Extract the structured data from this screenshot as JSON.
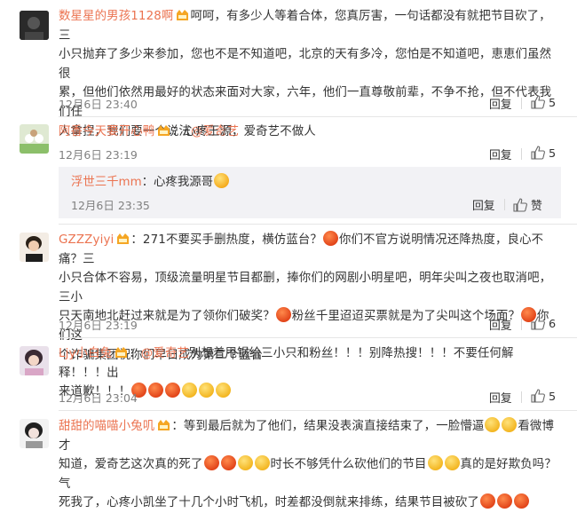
{
  "comments": [
    {
      "user": "数星星的男孩1128啊",
      "lines": [
        "呵呵，有多少人等着合体，您真厉害，一句话都没有就把节目砍了，三",
        "小只抛弃了多少来参加，您也不是不知道吧，北京的天有多冷，您怕是不知道吧，恵恵们虽然很",
        "累，但他们依然用最好的状态来面对大家，六年，他们一直尊敬前辈，不争不抢，但不代表我们任",
        "人拿捏，我们要一个说法"
      ],
      "mention": "@爱奇艺",
      "time": "12月6日 23:40",
      "reply": "回复",
      "likes": "5"
    },
    {
      "user": "阿香今天要开心鸭",
      "text": "：心疼王源，爱奇艺不做人",
      "time": "12月6日 23:19",
      "reply": "回复",
      "likes": "5",
      "sub": {
        "user": "浮世三千mm",
        "text": "：心疼我源哥",
        "time": "12月6日 23:35",
        "reply": "回复",
        "likes": "赞"
      }
    },
    {
      "user": "GZZZyiyi",
      "l1a": "：271不要买手删热度，横仿蓝台？",
      "l1b": "你们不官方说明情况还降热度，良心不痛？三",
      "l2": "小只合体不容易，顶级流量明星节目都删，捧你们的网剧小明星吧，明年尖叫之夜也取消吧，三小",
      "l3a": "只天南地北赶过来就是为了领你们破奖？",
      "l3b": "粉丝千里迢迢买票就是为了尖叫这个场面？",
      "l3c": "你们这",
      "l4": "个诈骗集团祝你们早日成为第二个蓝台",
      "time": "12月6日 23:19",
      "reply": "回复",
      "likes": "6"
    },
    {
      "user": "Ljy小白兔",
      "mention": "@爱奇艺",
      "l1": "别想着甩锅给三小只和粉丝！！！别降热搜！！！不要任何解释！！！出",
      "l2": "来道歉！！！",
      "time": "12月6日 23:04",
      "reply": "回复",
      "likes": "5"
    },
    {
      "user": "甜甜的喵喵小兔叽",
      "l1a": "：等到最后就为了他们，结果没表演直接结束了，一脸懵逼",
      "l1b": "看微博才",
      "l2a": "知道，爱奇艺这次真的死了",
      "l2b": "时长不够凭什么砍他们的节目",
      "l2c": "真的是好欺负吗？气",
      "l3": "死我了，心疼小凯坐了十几个小时飞机，时差都没倒就来排练，结果节目被砍了"
    }
  ],
  "colors": {
    "username": "#eb7350",
    "text": "#333333",
    "meta": "#808080",
    "sub_bg": "#f2f2f5"
  }
}
